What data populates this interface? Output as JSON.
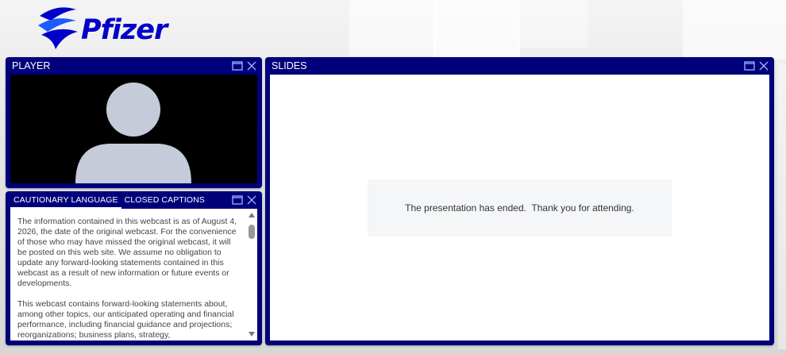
{
  "brand": {
    "logo_text": "Pfizer",
    "colors": {
      "primary": "#0000c9",
      "panel": "#00007a"
    }
  },
  "player": {
    "title": "PLAYER",
    "icons": [
      "maximize-icon",
      "close-icon",
      "avatar-placeholder-icon"
    ]
  },
  "cautionary": {
    "tabs": [
      {
        "label": "CAUTIONARY LANGUAGE",
        "active": true
      },
      {
        "label": "CLOSED CAPTIONS",
        "active": false
      }
    ],
    "paragraphs": [
      "The information contained in this webcast is as of August 4, 2026, the date of the original webcast. For the convenience of those who may have missed the original webcast, it will be posted on this web site. We assume no obligation to update any forward-looking statements contained in this webcast as a result of new information or future events or developments.",
      "This webcast contains forward-looking statements about, among other topics, our anticipated operating and financial performance, including financial guidance and projections; reorganizations; business plans, strategy,"
    ]
  },
  "slides": {
    "title": "SLIDES",
    "message": "The presentation has ended.  Thank you for attending."
  }
}
